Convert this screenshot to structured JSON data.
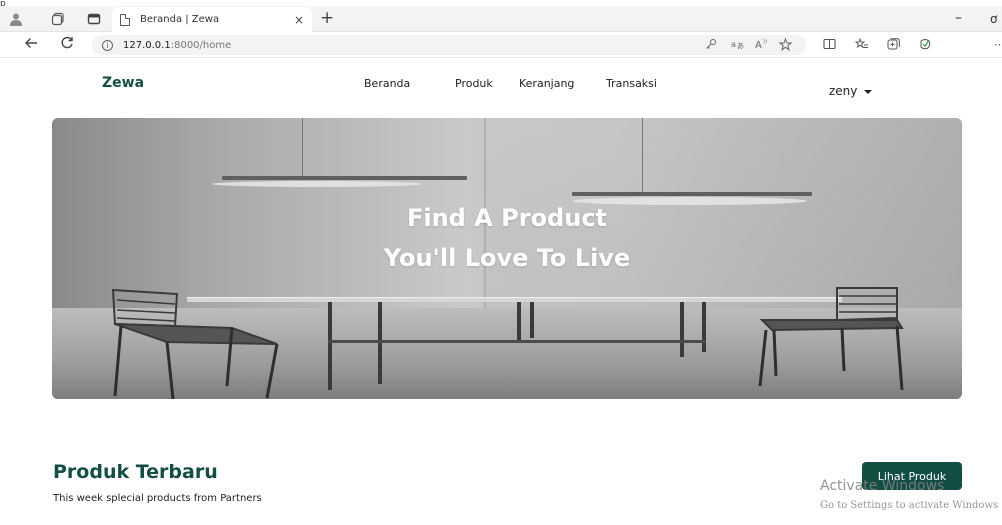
{
  "browser": {
    "tab_title": "Beranda | Zewa",
    "tab_close": "×",
    "new_tab": "+",
    "address_host": "127.0.0.1",
    "address_path": ":8000/home",
    "window_minimize": "–",
    "window_restore": "ơ",
    "corner_glyph": "p"
  },
  "site": {
    "brand": "Zewa",
    "nav": [
      "Beranda",
      "Produk",
      "Keranjang",
      "Transaksi"
    ],
    "user": "zeny"
  },
  "hero": {
    "line1": "Find A Product",
    "line2": "You'll Love To Live"
  },
  "section": {
    "title": "Produk Terbaru",
    "subtitle": "This week splecial products from Partners",
    "button": "Lihat Produk"
  },
  "watermark": {
    "title": "Activate Windows",
    "subtitle": "Go to Settings to activate Windows"
  }
}
